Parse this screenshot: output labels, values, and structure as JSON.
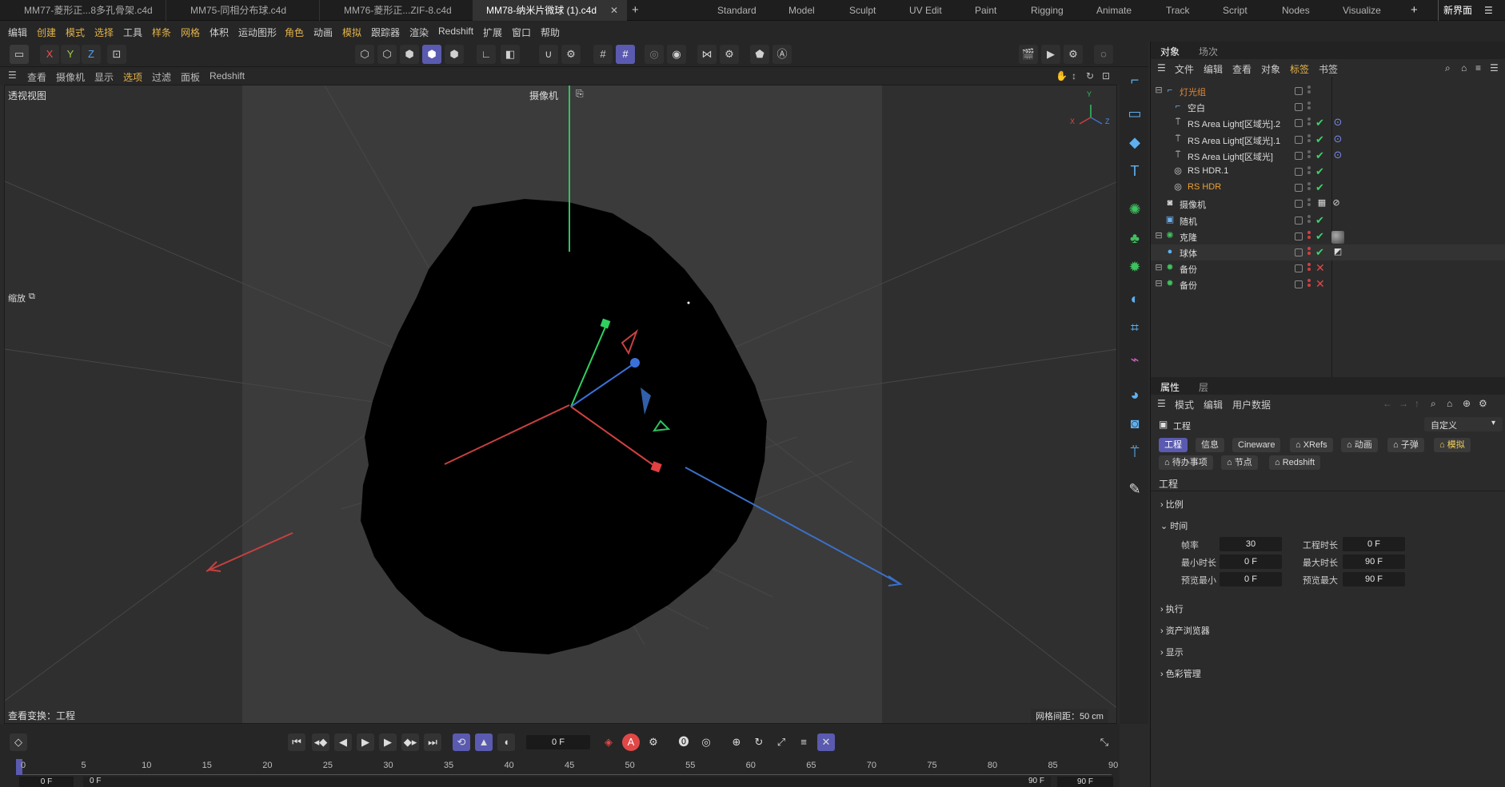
{
  "file_tabs": [
    {
      "label": "MM77-菱形正...8多孔骨架.c4d"
    },
    {
      "label": "MM75-同相分布球.c4d"
    },
    {
      "label": "MM76-菱形正...ZIF-8.c4d"
    },
    {
      "label": "MM78-纳米片微球 (1).c4d",
      "active": true
    }
  ],
  "layouts": [
    "Standard",
    "Model",
    "Sculpt",
    "UV Edit",
    "Paint",
    "Rigging",
    "Animate",
    "Track",
    "Script",
    "Nodes",
    "Visualize"
  ],
  "new_ui": "新界面",
  "menu": [
    "编辑",
    "创建",
    "模式",
    "选择",
    "工具",
    "样条",
    "网格",
    "体积",
    "运动图形",
    "角色",
    "动画",
    "模拟",
    "跟踪器",
    "渲染",
    "Redshift",
    "扩展",
    "窗口",
    "帮助"
  ],
  "axis_buttons": [
    "X",
    "Y",
    "Z"
  ],
  "viewport_menu": [
    "查看",
    "摄像机",
    "显示",
    "选项",
    "过滤",
    "面板",
    "Redshift"
  ],
  "viewport": {
    "title": "透视视图",
    "camera": "摄像机",
    "zoom_label": "缩放",
    "view_transform": "查看变换：工程",
    "grid_spacing": "网格间距：50 cm",
    "axis_labels": {
      "x": "X",
      "y": "Y",
      "z": "Z"
    }
  },
  "object_panel": {
    "tabs": [
      "对象",
      "场次"
    ],
    "menu": [
      "文件",
      "编辑",
      "查看",
      "对象",
      "标签",
      "书签"
    ],
    "objects": [
      {
        "name": "灯光组",
        "color": "#e0883a",
        "status": "none",
        "icon": "null-group-icon"
      },
      {
        "name": "空白",
        "color": "#dddddd",
        "status": "none",
        "icon": "null-icon"
      },
      {
        "name": "RS Area Light[区域光].2",
        "color": "#dddddd",
        "status": "check",
        "icon": "area-light-icon"
      },
      {
        "name": "RS Area Light[区域光].1",
        "color": "#dddddd",
        "status": "check",
        "icon": "area-light-icon"
      },
      {
        "name": "RS Area Light[区域光]",
        "color": "#dddddd",
        "status": "check",
        "icon": "area-light-icon"
      },
      {
        "name": "RS HDR.1",
        "color": "#dddddd",
        "status": "check",
        "icon": "hdr-icon"
      },
      {
        "name": "RS HDR",
        "color": "#f0a030",
        "status": "check",
        "icon": "hdr-icon"
      },
      {
        "name": "摄像机",
        "color": "#dddddd",
        "status": "none",
        "icon": "camera-icon"
      },
      {
        "name": "随机",
        "color": "#dddddd",
        "status": "check",
        "icon": "random-effector-icon"
      },
      {
        "name": "克隆",
        "color": "#dddddd",
        "status": "check",
        "icon": "cloner-icon"
      },
      {
        "name": "球体",
        "color": "#dddddd",
        "status": "check",
        "icon": "sphere-icon"
      },
      {
        "name": "备份",
        "color": "#dddddd",
        "status": "cross",
        "icon": "backup-icon"
      },
      {
        "name": "备份",
        "color": "#dddddd",
        "status": "cross",
        "icon": "backup-icon"
      }
    ]
  },
  "attr_panel": {
    "tabs": [
      "属性",
      "层"
    ],
    "menu": [
      "模式",
      "编辑",
      "用户数据"
    ],
    "header": "工程",
    "dropdown": "自定义",
    "pills_row1": [
      "工程",
      "信息",
      "Cineware",
      "XRefs",
      "动画",
      "子弹",
      "模拟"
    ],
    "pills_row2": [
      "待办事项",
      "节点",
      "Redshift"
    ],
    "section_title": "工程",
    "sections": [
      "比例",
      "时间",
      "执行",
      "资产浏览器",
      "显示",
      "色彩管理"
    ],
    "time_fields": {
      "frame_rate_label": "帧率",
      "frame_rate": "30",
      "project_length_label": "工程时长",
      "project_length": "0 F",
      "min_time_label": "最小时长",
      "min_time": "0 F",
      "max_time_label": "最大时长",
      "max_time": "90 F",
      "preview_min_label": "预览最小",
      "preview_min": "0 F",
      "preview_max_label": "预览最大",
      "preview_max": "90 F"
    }
  },
  "timeline": {
    "current_frame": "0 F",
    "ticks": [
      "0",
      "5",
      "10",
      "15",
      "20",
      "25",
      "30",
      "35",
      "40",
      "45",
      "50",
      "55",
      "60",
      "65",
      "70",
      "75",
      "80",
      "85",
      "90"
    ],
    "start_a": "0 F",
    "start_b": "0 F",
    "end_a": "90 F",
    "end_b": "90 F"
  }
}
